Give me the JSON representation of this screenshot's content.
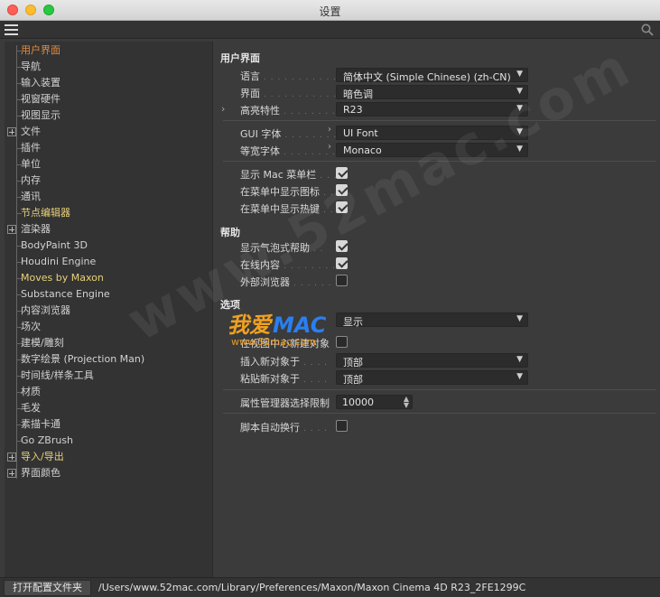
{
  "window": {
    "title": "设置"
  },
  "sidebar": {
    "items": [
      {
        "label": "用户界面",
        "expandable": false,
        "state": "active"
      },
      {
        "label": "导航",
        "expandable": false,
        "state": "normal"
      },
      {
        "label": "输入装置",
        "expandable": false,
        "state": "normal"
      },
      {
        "label": "视窗硬件",
        "expandable": false,
        "state": "normal"
      },
      {
        "label": "视图显示",
        "expandable": false,
        "state": "normal"
      },
      {
        "label": "文件",
        "expandable": true,
        "state": "normal"
      },
      {
        "label": "插件",
        "expandable": false,
        "state": "normal"
      },
      {
        "label": "单位",
        "expandable": false,
        "state": "normal"
      },
      {
        "label": "内存",
        "expandable": false,
        "state": "normal"
      },
      {
        "label": "通讯",
        "expandable": false,
        "state": "normal"
      },
      {
        "label": "节点编辑器",
        "expandable": false,
        "state": "accent"
      },
      {
        "label": "渲染器",
        "expandable": true,
        "state": "normal"
      },
      {
        "label": "BodyPaint 3D",
        "expandable": false,
        "state": "normal"
      },
      {
        "label": "Houdini Engine",
        "expandable": false,
        "state": "normal"
      },
      {
        "label": "Moves by Maxon",
        "expandable": false,
        "state": "accent"
      },
      {
        "label": "Substance Engine",
        "expandable": false,
        "state": "normal"
      },
      {
        "label": "内容浏览器",
        "expandable": false,
        "state": "normal"
      },
      {
        "label": "场次",
        "expandable": false,
        "state": "normal"
      },
      {
        "label": "建模/雕刻",
        "expandable": false,
        "state": "normal"
      },
      {
        "label": "数字绘景 (Projection Man)",
        "expandable": false,
        "state": "normal"
      },
      {
        "label": "时间线/样条工具",
        "expandable": false,
        "state": "normal"
      },
      {
        "label": "材质",
        "expandable": false,
        "state": "normal"
      },
      {
        "label": "毛发",
        "expandable": false,
        "state": "normal"
      },
      {
        "label": "素描卡通",
        "expandable": false,
        "state": "normal"
      },
      {
        "label": "Go ZBrush",
        "expandable": false,
        "state": "normal"
      },
      {
        "label": "导入/导出",
        "expandable": true,
        "state": "accent"
      },
      {
        "label": "界面颜色",
        "expandable": true,
        "state": "normal"
      }
    ]
  },
  "main": {
    "ui_section": {
      "title": "用户界面",
      "language": {
        "label": "语言",
        "value": "简体中文 (Simple Chinese) (zh-CN)"
      },
      "theme": {
        "label": "界面",
        "value": "暗色调"
      },
      "highlight": {
        "label": "高亮特性",
        "value": "R23"
      },
      "gui_font": {
        "label": "GUI 字体",
        "value": "UI Font"
      },
      "mono_font": {
        "label": "等宽字体",
        "value": "Monaco"
      },
      "show_mac_menubar": {
        "label": "显示 Mac 菜单栏",
        "checked": true
      },
      "show_menu_icons": {
        "label": "在菜单中显示图标",
        "checked": true
      },
      "show_menu_hotkeys": {
        "label": "在菜单中显示热键",
        "checked": true
      }
    },
    "help_section": {
      "title": "帮助",
      "bubble_help": {
        "label": "显示气泡式帮助",
        "checked": true
      },
      "online_content": {
        "label": "在线内容",
        "checked": true
      },
      "external_browser": {
        "label": "外部浏览器",
        "checked": false
      }
    },
    "options_section": {
      "title": "选项",
      "option1": {
        "value": "显示"
      },
      "create_in_view": {
        "label": "在视图中心新建对象"
      },
      "insert_new": {
        "label": "插入新对象于",
        "value": "顶部"
      },
      "paste_new": {
        "label": "粘贴新对象于",
        "value": "顶部"
      },
      "attr_limit": {
        "label": "属性管理器选择限制",
        "value": "10000"
      },
      "script_wrap": {
        "label": "脚本自动换行",
        "checked": false
      }
    }
  },
  "footer": {
    "open_folder_button": "打开配置文件夹",
    "path": "/Users/www.52mac.com/Library/Preferences/Maxon/Maxon Cinema 4D R23_2FE1299C"
  },
  "watermark": {
    "diagonal": "www.52mac.com",
    "logo_cn": "我爱",
    "logo_en": "MAC",
    "logo_url": "www.52mac.com"
  },
  "icons": {
    "menu": "hamburger-menu-icon",
    "search": "search-icon",
    "dropdown": "chevron-down-icon",
    "expand": "expand-plus-icon"
  }
}
